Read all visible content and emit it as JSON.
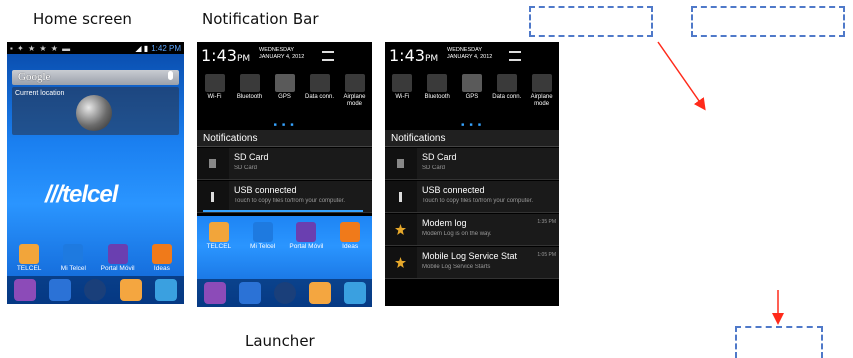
{
  "captions": {
    "home": "Home screen",
    "notification": "Notification Bar",
    "launcher": "Launcher"
  },
  "status_bar": {
    "time": "1:42 PM"
  },
  "home": {
    "search_label": "Google",
    "location_label": "Current location",
    "brand": "telcel",
    "apps": [
      {
        "label": "TELCEL",
        "color": "#f2a53a"
      },
      {
        "label": "Mi Telcel",
        "color": "#1e7ae0"
      },
      {
        "label": "Portal Móvil",
        "color": "#6a3fb0"
      },
      {
        "label": "Ideas",
        "color": "#f07a1a"
      }
    ],
    "dock": [
      {
        "icon": "grid-icon",
        "color": "#8c4bb8"
      },
      {
        "icon": "contacts-icon",
        "color": "#2b72d6"
      },
      {
        "icon": "app-drawer-icon",
        "color": "#1a3f7a"
      },
      {
        "icon": "mail-icon",
        "color": "#f4a640"
      },
      {
        "icon": "map-icon",
        "color": "#3aa0e0"
      }
    ]
  },
  "notification_shade": {
    "clock": "1:43",
    "clock_suffix": "PM",
    "weekday": "WEDNESDAY",
    "date": "JANUARY 4, 2012",
    "toggles": [
      {
        "label": "Wi-Fi",
        "on": false
      },
      {
        "label": "Bluetooth",
        "on": false
      },
      {
        "label": "GPS",
        "on": true
      },
      {
        "label": "Data conn.",
        "on": false
      },
      {
        "label": "Airplane mode",
        "on": false
      }
    ],
    "header": "Notifications",
    "items_short": [
      {
        "title": "SD Card",
        "sub": "SD Card"
      },
      {
        "title": "USB connected",
        "sub": "Touch to copy files to/from your computer."
      }
    ],
    "items_full": [
      {
        "title": "SD Card",
        "sub": "SD Card",
        "time": ""
      },
      {
        "title": "USB connected",
        "sub": "Touch to copy files to/from your computer.",
        "time": ""
      },
      {
        "title": "Modem log",
        "sub": "Modem Log is on the way.",
        "time": "1:35 PM"
      },
      {
        "title": "Mobile Log Service Stat",
        "sub": "Mobile Log Service Starts",
        "time": "1:05 PM"
      }
    ]
  },
  "annotation_colors": {
    "dashed": "#4f79c9",
    "arrow": "#ff2a1a"
  }
}
